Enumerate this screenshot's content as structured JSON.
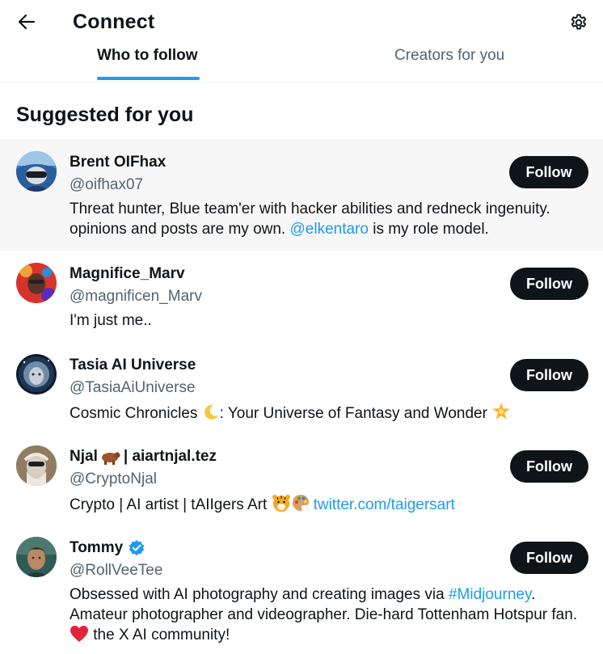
{
  "header": {
    "title": "Connect",
    "back_icon": "arrow-left-icon",
    "settings_icon": "gear-icon"
  },
  "tabs": [
    {
      "label": "Who to follow",
      "active": true
    },
    {
      "label": "Creators for you",
      "active": false
    }
  ],
  "section": {
    "title": "Suggested for you"
  },
  "users": [
    {
      "name": "Brent OIFhax",
      "handle": "@oifhax07",
      "bio_parts": [
        "Threat hunter, Blue team'er with hacker abilities and redneck ingenuity. opinions and posts are my own. ",
        "@elkentaro",
        " is my role model."
      ],
      "follow_label": "Follow"
    },
    {
      "name": "Magnifice_Marv",
      "handle": "@magnificen_Marv",
      "bio": "I'm just me..",
      "follow_label": "Follow"
    },
    {
      "name": "Tasia AI Universe",
      "handle": "@TasiaAiUniverse",
      "bio_parts": [
        "Cosmic Chronicles ",
        ": Your Universe of Fantasy and Wonder "
      ],
      "follow_label": "Follow"
    },
    {
      "name_parts": [
        "Njal ",
        " | aiartnjal.tez"
      ],
      "handle": "@CryptoNjal",
      "bio_parts": [
        "Crypto | AI artist | tAIIgers Art ",
        "twitter.com/taigersart"
      ],
      "follow_label": "Follow"
    },
    {
      "name": "Tommy",
      "verified": true,
      "handle": "@RollVeeTee",
      "bio_parts": [
        "Obsessed with AI photography and creating images via ",
        "#Midjourney",
        ". Amateur photographer and videographer. Die-hard Tottenham Hotspur fan. ",
        " the X AI community!"
      ],
      "follow_label": "Follow"
    }
  ],
  "colors": {
    "accent": "#1d9bf0",
    "text_primary": "#0f1419",
    "text_secondary": "#536471",
    "button_bg": "#0f1419",
    "highlight_row": "#f7f7f7"
  }
}
